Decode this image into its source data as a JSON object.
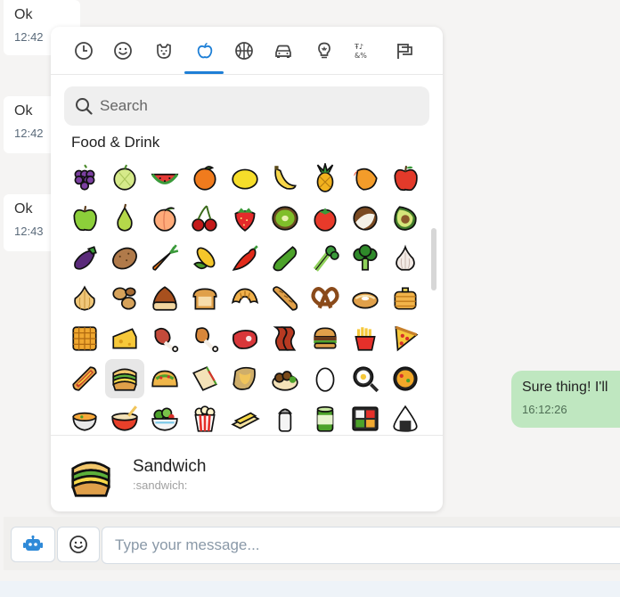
{
  "chat": {
    "incoming": [
      {
        "text": "Ok",
        "time": "12:42"
      },
      {
        "text": "Ok",
        "time": "12:42"
      },
      {
        "text": "Ok",
        "time": "12:43"
      }
    ],
    "outgoing": [
      {
        "text": "Sure thing! I'll",
        "time": "16:12:26"
      }
    ]
  },
  "composer": {
    "placeholder": "Type your message...",
    "bot_icon": "robot-icon",
    "emoji_icon": "smiley-icon"
  },
  "picker": {
    "categories": [
      {
        "name": "recent",
        "icon": "clock-icon"
      },
      {
        "name": "people",
        "icon": "smiley-icon"
      },
      {
        "name": "nature",
        "icon": "dog-icon"
      },
      {
        "name": "food",
        "icon": "apple-icon",
        "active": true
      },
      {
        "name": "activity",
        "icon": "basketball-icon"
      },
      {
        "name": "travel",
        "icon": "car-icon"
      },
      {
        "name": "objects",
        "icon": "lightbulb-icon"
      },
      {
        "name": "symbols",
        "icon": "symbols-icon"
      },
      {
        "name": "flags",
        "icon": "flag-icon"
      }
    ],
    "search_placeholder": "Search",
    "section_title": "Food & Drink",
    "emojis": [
      "grapes",
      "melon",
      "watermelon",
      "tangerine",
      "lemon",
      "banana",
      "pineapple",
      "mango",
      "red-apple",
      "green-apple",
      "pear",
      "peach",
      "cherries",
      "strawberry",
      "kiwi",
      "tomato",
      "coconut",
      "avocado",
      "eggplant",
      "potato",
      "carrot",
      "corn",
      "hot-pepper",
      "cucumber",
      "celery",
      "broccoli",
      "garlic",
      "onion",
      "peanuts",
      "chestnut",
      "bread",
      "croissant",
      "baguette",
      "pretzel",
      "bagel",
      "pancakes",
      "waffle",
      "cheese",
      "meat-on-bone",
      "poultry-leg",
      "steak",
      "bacon",
      "hamburger",
      "fries",
      "pizza",
      "hotdog",
      "sandwich",
      "taco",
      "burrito",
      "tamale",
      "falafel",
      "egg",
      "fried-egg",
      "paella",
      "soup",
      "bowl",
      "salad",
      "popcorn",
      "butter",
      "salt",
      "canned-food",
      "bento",
      "onigiri"
    ],
    "selected_emoji": "sandwich",
    "preview": {
      "name": "Sandwich",
      "code": ":sandwich:"
    }
  },
  "colors": {
    "accent": "#1e7fd6",
    "outgoing_bubble": "#bfe7c0",
    "timestamp": "#5b6b7b"
  }
}
